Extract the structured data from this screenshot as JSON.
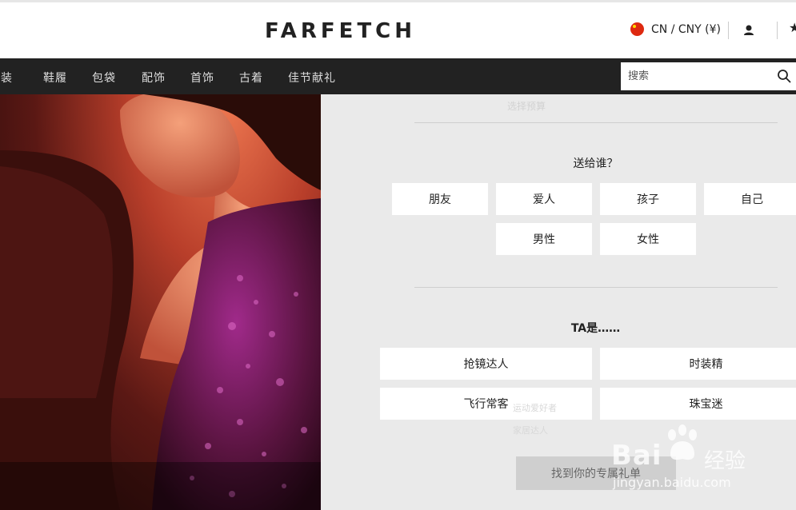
{
  "header": {
    "logo": "FARFETCH",
    "region": "CN / CNY (¥)",
    "user_icon": "user-icon",
    "star_icon": "star-icon"
  },
  "nav": {
    "items": [
      {
        "label": "服装"
      },
      {
        "label": "鞋履"
      },
      {
        "label": "包袋"
      },
      {
        "label": "配饰"
      },
      {
        "label": "首饰"
      },
      {
        "label": "古着"
      },
      {
        "label": "佳节献礼"
      }
    ],
    "search": {
      "placeholder": "搜索",
      "icon": "search-icon"
    }
  },
  "gift_finder": {
    "faded_top": "选择预算",
    "q1": {
      "title": "送给谁？",
      "options": [
        "朋友",
        "爱人",
        "孩子",
        "自己",
        "男性",
        "女性"
      ]
    },
    "q2": {
      "title": "TA是……",
      "options": [
        "抢镜达人",
        "时装精",
        "飞行常客",
        "珠宝迷"
      ]
    },
    "ghost_texts": [
      "运动爱好者",
      "家居达人"
    ],
    "cta": "找到你的专属礼单"
  },
  "watermark": {
    "brand": "Bai",
    "brand_cn": "经验",
    "url": "jingyan.baidu.com"
  }
}
